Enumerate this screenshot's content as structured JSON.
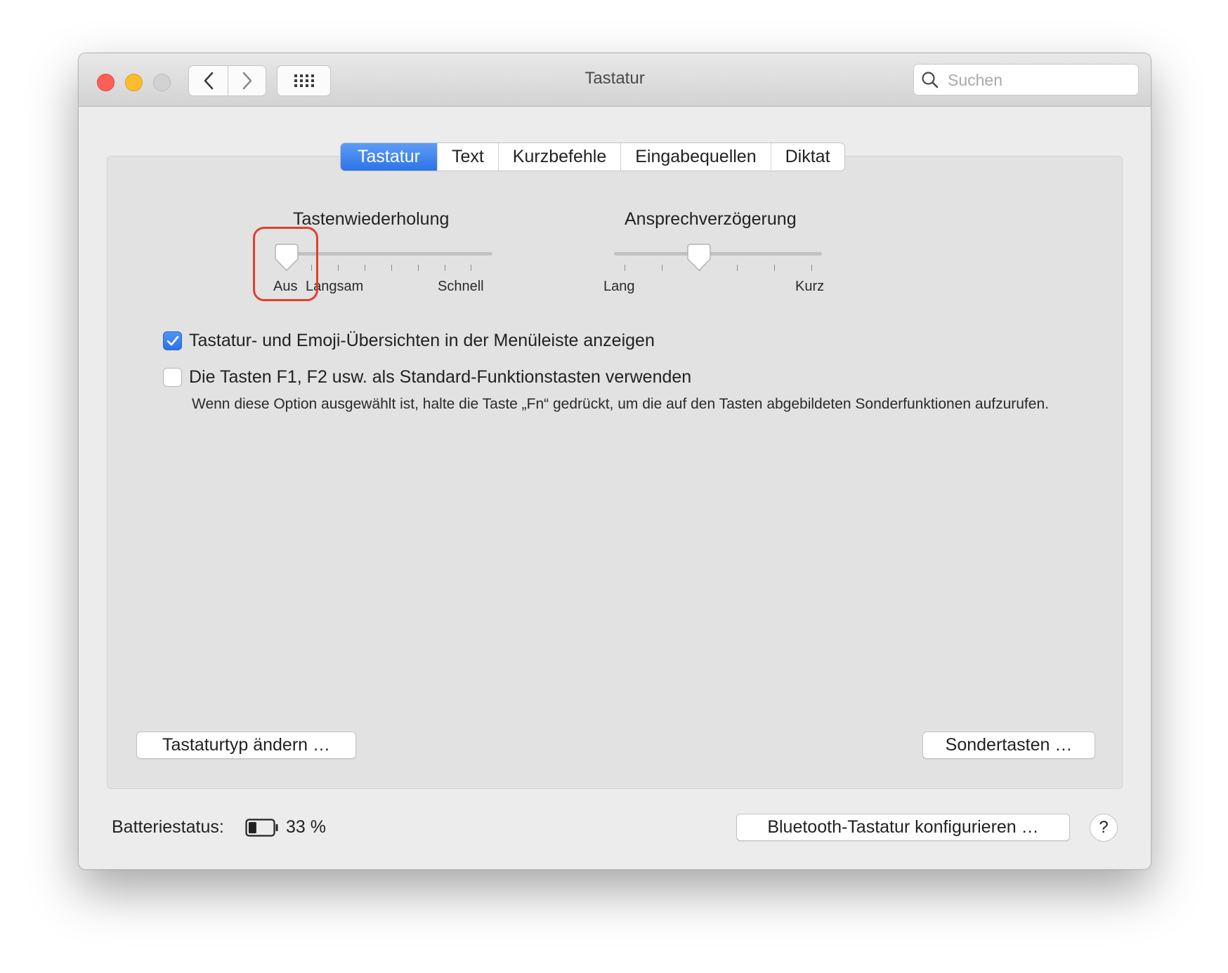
{
  "window": {
    "title": "Tastatur",
    "search_placeholder": "Suchen"
  },
  "tabs": [
    {
      "label": "Tastatur",
      "active": true
    },
    {
      "label": "Text",
      "active": false
    },
    {
      "label": "Kurzbefehle",
      "active": false
    },
    {
      "label": "Eingabequellen",
      "active": false
    },
    {
      "label": "Diktat",
      "active": false
    }
  ],
  "key_repeat": {
    "title": "Tastenwiederholung",
    "label_off": "Aus",
    "label_slow": "Langsam",
    "label_fast": "Schnell",
    "position": "Aus"
  },
  "delay_until_repeat": {
    "title": "Ansprechverzögerung",
    "label_long": "Lang",
    "label_short": "Kurz",
    "level": 0.4
  },
  "options": {
    "show_viewers_label": "Tastatur- und Emoji-Übersichten in der Menüleiste anzeigen",
    "show_viewers_checked": true,
    "fn_keys_label": "Die Tasten F1, F2 usw. als Standard-Funktionstasten verwenden",
    "fn_keys_checked": false,
    "fn_keys_note": "Wenn diese Option ausgewählt ist, halte die Taste „Fn“ gedrückt, um die auf den Tasten abgebildeten Sonderfunktionen aufzurufen."
  },
  "buttons": {
    "change_keyboard_type": "Tastaturtyp ändern …",
    "modifier_keys": "Sondertasten …",
    "bluetooth_setup": "Bluetooth-Tastatur konfigurieren …",
    "help": "?"
  },
  "battery": {
    "label": "Batteriestatus:",
    "percent_text": "33 %",
    "level": 0.33
  },
  "colors": {
    "accent": "#2d73e8",
    "highlight_box": "#e0402e"
  }
}
